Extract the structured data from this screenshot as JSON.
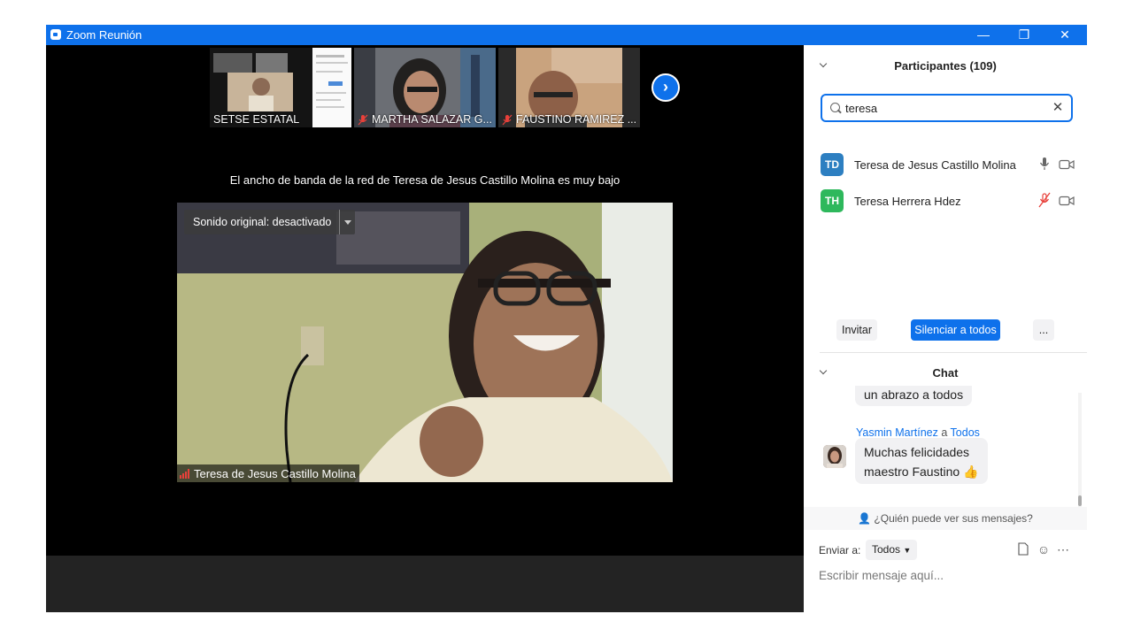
{
  "window": {
    "title": "Zoom Reunión",
    "controls": {
      "minimize": "—",
      "restore": "❐",
      "close": "✕"
    }
  },
  "gallery": {
    "thumbnails": [
      {
        "name": "SETSE ESTATAL",
        "muted": false
      },
      {
        "name": "MARTHA SALAZAR G...",
        "muted": true
      },
      {
        "name": "FAUSTINO RAMIREZ ...",
        "muted": true
      }
    ],
    "next_icon": "chevron-right-icon"
  },
  "stage": {
    "bandwidth_notice": "El ancho de banda de la red de Teresa de Jesus Castillo Molina es muy bajo",
    "original_sound": "Sonido original: desactivado",
    "speaker_name": "Teresa de Jesus Castillo Molina"
  },
  "participants": {
    "title": "Participantes (109)",
    "search_value": "teresa",
    "list": [
      {
        "initials": "TD",
        "name": "Teresa de Jesus Castillo Molina",
        "avatar_color": "#2d7fc1",
        "mic_muted": false
      },
      {
        "initials": "TH",
        "name": "Teresa Herrera Hdez",
        "avatar_color": "#2eb85c",
        "mic_muted": true
      }
    ],
    "buttons": {
      "invite": "Invitar",
      "mute_all": "Silenciar a todos",
      "more": "..."
    }
  },
  "chat": {
    "title": "Chat",
    "messages": [
      {
        "text": "un abrazo a todos"
      },
      {
        "sender": "Yasmin Martínez",
        "separator": "a",
        "recipient": "Todos",
        "line1": "Muchas felicidades",
        "line2": "maestro Faustino",
        "emoji": "👍"
      }
    ],
    "who_can_see": "¿Quién puede ver sus mensajes?",
    "send_to_label": "Enviar a:",
    "send_to_value": "Todos",
    "input_placeholder": "Escribir mensaje aquí...",
    "colors": {
      "accent": "#0e71eb",
      "muted_mic": "#e8403a"
    }
  }
}
